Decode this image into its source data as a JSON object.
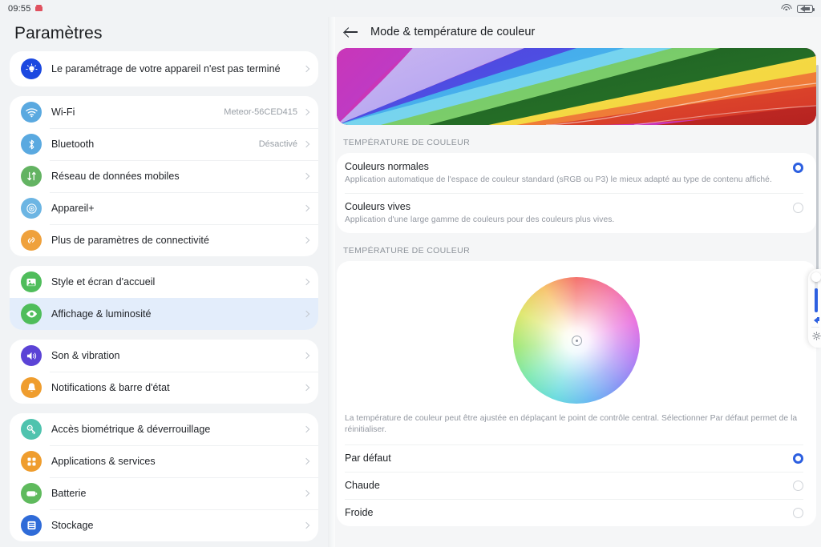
{
  "statusbar": {
    "time": "09:55",
    "alarm_icon": "alarm-icon",
    "wifi_icon": "wifi-icon",
    "battery_icon": "battery-charging-icon"
  },
  "sidebar": {
    "title": "Paramètres",
    "groups": [
      {
        "items": [
          {
            "label": "Le paramétrage de votre appareil n'est pas terminé",
            "value": "",
            "icon": "setup-bulb-icon",
            "color": "#1b48e0",
            "selected": false
          }
        ]
      },
      {
        "items": [
          {
            "label": "Wi-Fi",
            "value": "Meteor-56CED415",
            "icon": "wifi-icon",
            "color": "#5aa9e0",
            "selected": false
          },
          {
            "label": "Bluetooth",
            "value": "Désactivé",
            "icon": "bluetooth-icon",
            "color": "#5aa9e0",
            "selected": false
          },
          {
            "label": "Réseau de données mobiles",
            "value": "",
            "icon": "mobile-data-icon",
            "color": "#63b362",
            "selected": false
          },
          {
            "label": "Appareil+",
            "value": "",
            "icon": "device-plus-icon",
            "color": "#6cb5e3",
            "selected": false
          },
          {
            "label": "Plus de paramètres de connectivité",
            "value": "",
            "icon": "link-icon",
            "color": "#efa13c",
            "selected": false
          }
        ]
      },
      {
        "items": [
          {
            "label": "Style et écran d'accueil",
            "value": "",
            "icon": "wallpaper-icon",
            "color": "#4fbd5b",
            "selected": false
          },
          {
            "label": "Affichage & luminosité",
            "value": "",
            "icon": "display-eye-icon",
            "color": "#4fbd5b",
            "selected": true
          }
        ]
      },
      {
        "items": [
          {
            "label": "Son & vibration",
            "value": "",
            "icon": "sound-icon",
            "color": "#5b43d6",
            "selected": false
          },
          {
            "label": "Notifications & barre d'état",
            "value": "",
            "icon": "bell-icon",
            "color": "#ef9d2e",
            "selected": false
          }
        ]
      },
      {
        "items": [
          {
            "label": "Accès biométrique & déverrouillage",
            "value": "",
            "icon": "key-icon",
            "color": "#4fc3ae",
            "selected": false
          },
          {
            "label": "Applications & services",
            "value": "",
            "icon": "apps-grid-icon",
            "color": "#ef9d2e",
            "selected": false
          },
          {
            "label": "Batterie",
            "value": "",
            "icon": "battery-icon",
            "color": "#5fba5d",
            "selected": false
          },
          {
            "label": "Stockage",
            "value": "",
            "icon": "storage-icon",
            "color": "#2f6bd8",
            "selected": false
          }
        ]
      }
    ]
  },
  "detail": {
    "back_icon": "back-arrow-icon",
    "title": "Mode & température de couleur",
    "banner_icon": "rainbow-banner-image",
    "mode_section": {
      "heading": "TEMPÉRATURE DE COULEUR",
      "options": [
        {
          "title": "Couleurs normales",
          "subtitle": "Application automatique de l'espace de couleur standard (sRGB ou P3) le mieux adapté au type de contenu affiché.",
          "selected": true
        },
        {
          "title": "Couleurs vives",
          "subtitle": "Application d'une large gamme de couleurs pour des couleurs plus vives.",
          "selected": false
        }
      ]
    },
    "temp_section": {
      "heading": "TEMPÉRATURE DE COULEUR",
      "wheel_icon": "color-wheel-picker",
      "wheel_handle_icon": "color-wheel-handle",
      "note": "La température de couleur peut être ajustée en déplaçant le point de contrôle central. Sélectionner Par défaut permet de la réinitialiser.",
      "options": [
        {
          "title": "Par défaut",
          "selected": true
        },
        {
          "title": "Chaude",
          "selected": false
        },
        {
          "title": "Froide",
          "selected": false
        }
      ]
    }
  },
  "overlays": {
    "scrollbar_icon": "vertical-scrollbar",
    "volume_panel": {
      "slider_icon": "volume-slider",
      "speaker_icon": "speaker-icon",
      "settings_icon": "gear-icon"
    }
  },
  "colors": {
    "accent": "#2c5fe0",
    "selected_row_bg": "#e3edfb",
    "page_bg": "#f1f3f5",
    "card_bg": "#ffffff"
  }
}
